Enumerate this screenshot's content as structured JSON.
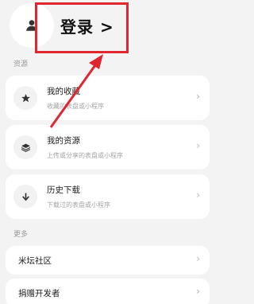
{
  "header": {
    "login_label": "登录 >"
  },
  "resources": {
    "section_label": "资源",
    "items": [
      {
        "title": "我的收藏",
        "subtitle": "收藏的表盘或小程序",
        "icon": "star-icon"
      },
      {
        "title": "我的资源",
        "subtitle": "上传或分享的表盘或小程序",
        "icon": "layers-icon"
      },
      {
        "title": "历史下载",
        "subtitle": "下载过的表盘或小程序",
        "icon": "download-icon"
      }
    ]
  },
  "more": {
    "section_label": "更多",
    "items": [
      {
        "label": "米坛社区"
      },
      {
        "label": "捐赠开发者"
      }
    ]
  },
  "annotation_color": "#e0262f",
  "chevron_glyph": "›"
}
